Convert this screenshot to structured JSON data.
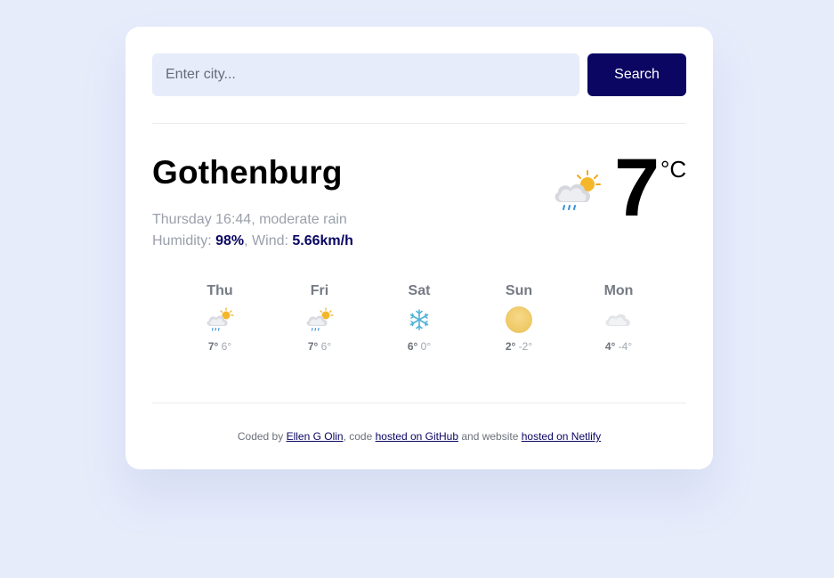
{
  "search": {
    "placeholder": "Enter city...",
    "value": "",
    "button_label": "Search"
  },
  "current": {
    "city": "Gothenburg",
    "day_time": "Thursday 16:44",
    "description": "moderate rain",
    "humidity_label": "Humidity: ",
    "humidity": "98%",
    "wind_label": "Wind: ",
    "wind": "5.66km/h",
    "temperature": "7",
    "unit": "°C",
    "icon": "sun-cloud-rain-icon"
  },
  "forecast": [
    {
      "day": "Thu",
      "max": "7°",
      "min": "6°",
      "icon": "sun-cloud-rain-icon"
    },
    {
      "day": "Fri",
      "max": "7°",
      "min": "6°",
      "icon": "sun-cloud-rain-icon"
    },
    {
      "day": "Sat",
      "max": "6°",
      "min": "0°",
      "icon": "snowflake-icon"
    },
    {
      "day": "Sun",
      "max": "2°",
      "min": "-2°",
      "icon": "sun-icon"
    },
    {
      "day": "Mon",
      "max": "4°",
      "min": "-4°",
      "icon": "cloud-icon"
    }
  ],
  "footer": {
    "prefix": "Coded by ",
    "author_link": "Ellen G Olin",
    "middle": ", code ",
    "github_link": "hosted on GitHub",
    "middle2": " and website ",
    "netlify_link": "hosted on Netlify"
  },
  "colors": {
    "background": "#e7ecfb",
    "accent": "#0a0662",
    "card": "#ffffff"
  }
}
